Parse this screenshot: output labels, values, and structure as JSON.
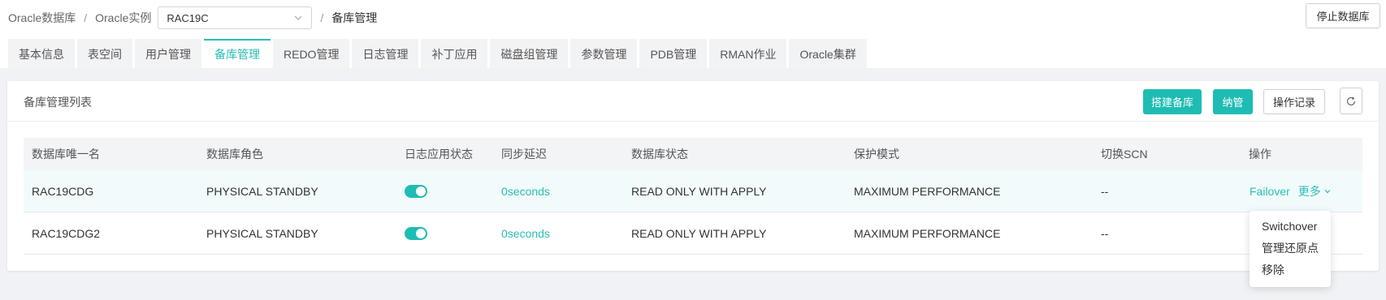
{
  "breadcrumb": {
    "root": "Oracle数据库",
    "instance_label": "Oracle实例",
    "instance_value": "RAC19C",
    "current": "备库管理"
  },
  "header": {
    "stop_db_label": "停止数据库"
  },
  "tabs": [
    {
      "label": "基本信息",
      "active": false
    },
    {
      "label": "表空间",
      "active": false
    },
    {
      "label": "用户管理",
      "active": false
    },
    {
      "label": "备库管理",
      "active": true
    },
    {
      "label": "REDO管理",
      "active": false
    },
    {
      "label": "日志管理",
      "active": false
    },
    {
      "label": "补丁应用",
      "active": false
    },
    {
      "label": "磁盘组管理",
      "active": false
    },
    {
      "label": "参数管理",
      "active": false
    },
    {
      "label": "PDB管理",
      "active": false
    },
    {
      "label": "RMAN作业",
      "active": false
    },
    {
      "label": "Oracle集群",
      "active": false
    }
  ],
  "card": {
    "title": "备库管理列表",
    "build_standby_label": "搭建备库",
    "manage_label": "纳管",
    "op_log_label": "操作记录",
    "refresh_icon": "refresh-icon"
  },
  "table": {
    "columns": [
      "数据库唯一名",
      "数据库角色",
      "日志应用状态",
      "同步延迟",
      "数据库状态",
      "保护模式",
      "切换SCN",
      "操作"
    ],
    "rows": [
      {
        "db_unique_name": "RAC19CDG",
        "role": "PHYSICAL STANDBY",
        "apply_on": true,
        "lag": "0seconds",
        "status": "READ ONLY WITH APPLY",
        "protection": "MAXIMUM PERFORMANCE",
        "switch_scn": "--",
        "action": "Failover",
        "more": "更多"
      },
      {
        "db_unique_name": "RAC19CDG2",
        "role": "PHYSICAL STANDBY",
        "apply_on": true,
        "lag": "0seconds",
        "status": "READ ONLY WITH APPLY",
        "protection": "MAXIMUM PERFORMANCE",
        "switch_scn": "--"
      }
    ]
  },
  "more_menu": [
    "Switchover",
    "管理还原点",
    "移除"
  ],
  "colors": {
    "accent": "#1ebcb3",
    "link": "#2bbdb6"
  }
}
